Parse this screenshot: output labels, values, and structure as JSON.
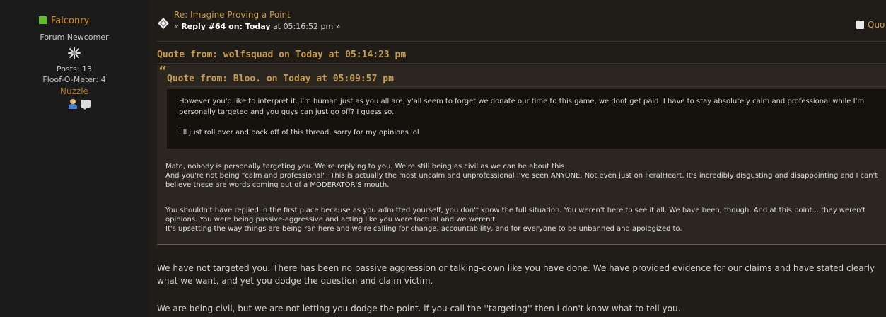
{
  "poster": {
    "name": "Falconry",
    "group": "Forum Newcomer",
    "posts": "Posts: 13",
    "meter": "Floof-O-Meter: 4",
    "custom_title": "Nuzzle",
    "icons": [
      "profile-icon",
      "pm-icon"
    ],
    "online_color": "#5fbd2e"
  },
  "post": {
    "subject": "Re: Imagine Proving a Point",
    "meta_prefix": "« ",
    "reply_label": "Reply #64 on: Today",
    "meta_time": " at 05:16:52 pm »",
    "quote_button": "Quo"
  },
  "quote_outer": {
    "header": "Quote from: wolfsquad on Today at 05:14:23 pm",
    "inner": {
      "header": "Quote from: Bloo. on Today at 05:09:57 pm",
      "paragraphs": [
        "However you'd like to interpret it. I'm human just as you all are, y'all seem to forget we donate our time to this game, we dont get paid. I have to stay absolutely calm and professional while I'm personally targeted and you guys can just go off? I guess so.",
        "I'll just roll over and back off of this thread, sorry for my opinions lol"
      ]
    },
    "paragraphs": [
      "Mate, nobody is personally targeting you. We're replying to you. We're still being as civil as we can be about this.\nAnd you're not being \"calm and professional\". This is actually the most uncalm and unprofessional I've seen ANYONE. Not even just on FeralHeart. It's incredibly disgusting and disappointing and I can't believe these are words coming out of a MODERATOR'S mouth.",
      "You shouldn't have replied in the first place because as you admitted yourself, you don't know the full situation. You weren't here to see it all. We have been, though. And at this point... they weren't opinions. You were being passive-aggressive and acting like you were factual and we weren't.\nIt's upsetting the way things are being ran here and we're calling for change, accountability, and for everyone to be unbanned and apologized to."
    ]
  },
  "reply": {
    "paragraphs": [
      "We have not targeted you. There has been no passive aggression or talking-down like you have done. We have provided evidence for our claims and have stated clearly what we want, and yet you dodge the question and claim victim.",
      "We are being civil, but we are not letting you dodge the point. if you call the ''targeting'' then I don't know what to tell you."
    ]
  }
}
